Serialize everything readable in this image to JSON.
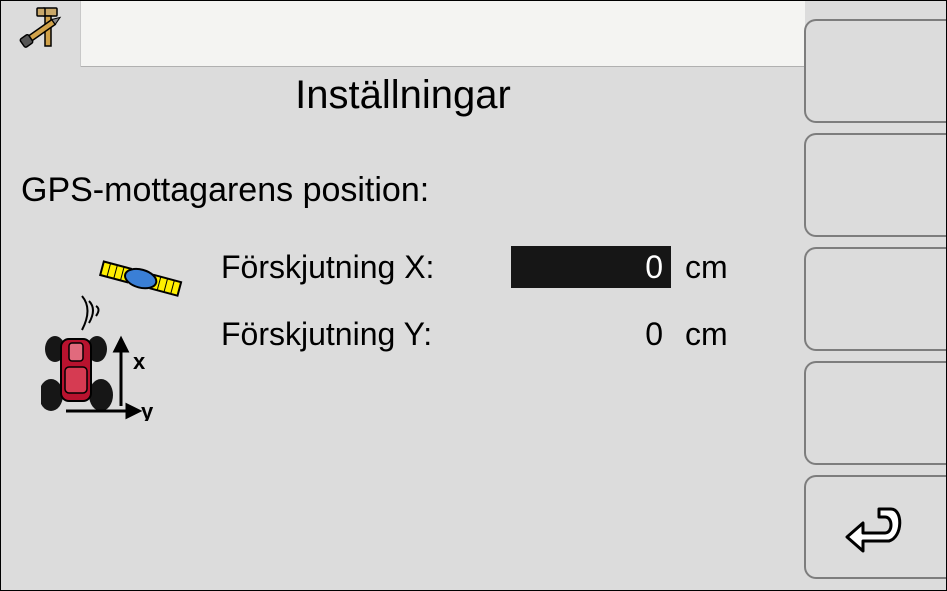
{
  "header": {
    "title": "Inställningar"
  },
  "section": {
    "label": "GPS-mottagarens position:"
  },
  "offset_x": {
    "label": "Förskjutning X:",
    "value": "0",
    "unit": "cm",
    "active": true
  },
  "offset_y": {
    "label": "Förskjutning Y:",
    "value": "0",
    "unit": "cm",
    "active": false
  },
  "diagram": {
    "x_axis_label": "x",
    "y_axis_label": "y"
  }
}
